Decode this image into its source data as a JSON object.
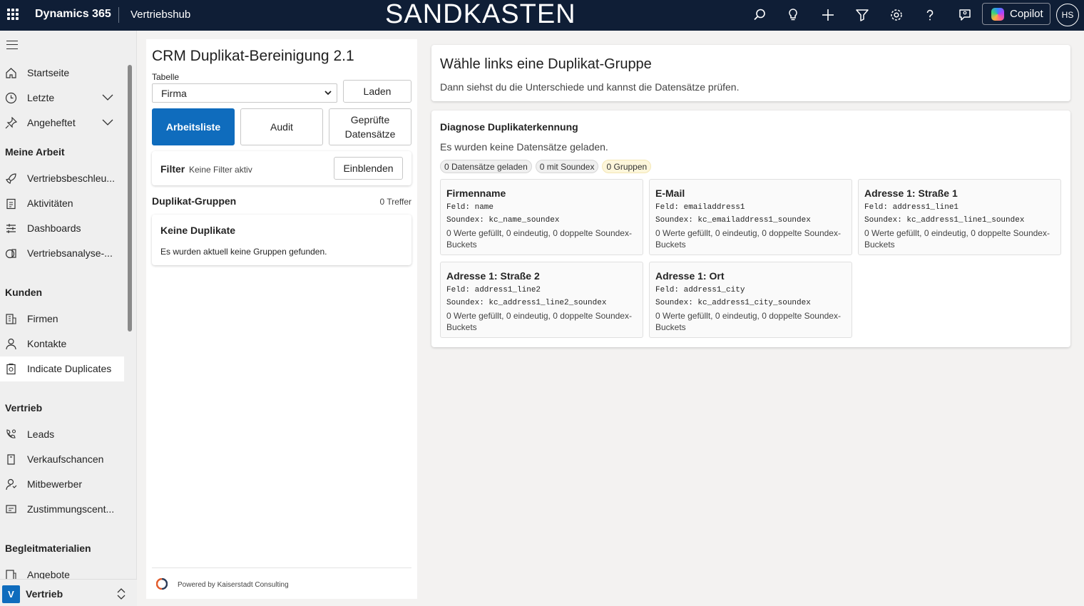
{
  "header": {
    "brand": "Dynamics 365",
    "app": "Vertriebshub",
    "environment": "SANDKASTEN",
    "copilot_label": "Copilot",
    "avatar_initials": "HS"
  },
  "sidebar": {
    "top_items": [
      {
        "label": "Startseite",
        "icon": "home-icon"
      },
      {
        "label": "Letzte",
        "icon": "clock-icon"
      },
      {
        "label": "Angeheftet",
        "icon": "pin-icon"
      }
    ],
    "sections": [
      {
        "title": "Meine Arbeit",
        "items": [
          "Vertriebsbeschleu...",
          "Aktivitäten",
          "Dashboards",
          "Vertriebsanalyse-..."
        ]
      },
      {
        "title": "Kunden",
        "items": [
          "Firmen",
          "Kontakte",
          "Indicate Duplicates"
        ]
      },
      {
        "title": "Vertrieb",
        "items": [
          "Leads",
          "Verkaufschancen",
          "Mitbewerber",
          "Zustimmungscent..."
        ]
      },
      {
        "title": "Begleitmaterialien",
        "items": [
          "Angebote"
        ]
      }
    ],
    "active_item": "Indicate Duplicates",
    "area_badge": "V",
    "area_label": "Vertrieb"
  },
  "left": {
    "title": "CRM Duplikat-Bereinigung 2.1",
    "table_label": "Tabelle",
    "table_value": "Firma",
    "load_button": "Laden",
    "tabs": [
      "Arbeitsliste",
      "Audit",
      "Geprüfte Datensätze"
    ],
    "filter_label": "Filter",
    "filter_status": "Keine Filter aktiv",
    "filter_button": "Einblenden",
    "groups_title": "Duplikat-Gruppen",
    "hits": "0 Treffer",
    "empty_title": "Keine Duplikate",
    "empty_text": "Es wurden aktuell keine Gruppen gefunden.",
    "footer": "Powered by Kaiserstadt Consulting"
  },
  "right": {
    "title": "Wähle links eine Duplikat-Gruppe",
    "subtitle": "Dann siehst du die Unterschiede und kannst die Datensätze prüfen.",
    "diag_title": "Diagnose Duplikaterkennung",
    "diag_text": "Es wurden keine Datensätze geladen.",
    "chips": [
      "0 Datensätze geladen",
      "0 mit Soundex",
      "0 Gruppen"
    ],
    "fields": [
      {
        "title": "Firmenname",
        "feld": "Feld: name",
        "soundex": "Soundex: kc_name_soundex",
        "stats": "0 Werte gefüllt, 0 eindeutig, 0 doppelte Soundex-Buckets"
      },
      {
        "title": "E-Mail",
        "feld": "Feld: emailaddress1",
        "soundex": "Soundex: kc_emailaddress1_soundex",
        "stats": "0 Werte gefüllt, 0 eindeutig, 0 doppelte Soundex-Buckets"
      },
      {
        "title": "Adresse 1: Straße 1",
        "feld": "Feld: address1_line1",
        "soundex": "Soundex: kc_address1_line1_soundex",
        "stats": "0 Werte gefüllt, 0 eindeutig, 0 doppelte Soundex-Buckets"
      },
      {
        "title": "Adresse 1: Straße 2",
        "feld": "Feld: address1_line2",
        "soundex": "Soundex: kc_address1_line2_soundex",
        "stats": "0 Werte gefüllt, 0 eindeutig, 0 doppelte Soundex-Buckets"
      },
      {
        "title": "Adresse 1: Ort",
        "feld": "Feld: address1_city",
        "soundex": "Soundex: kc_address1_city_soundex",
        "stats": "0 Werte gefüllt, 0 eindeutig, 0 doppelte Soundex-Buckets"
      }
    ]
  }
}
